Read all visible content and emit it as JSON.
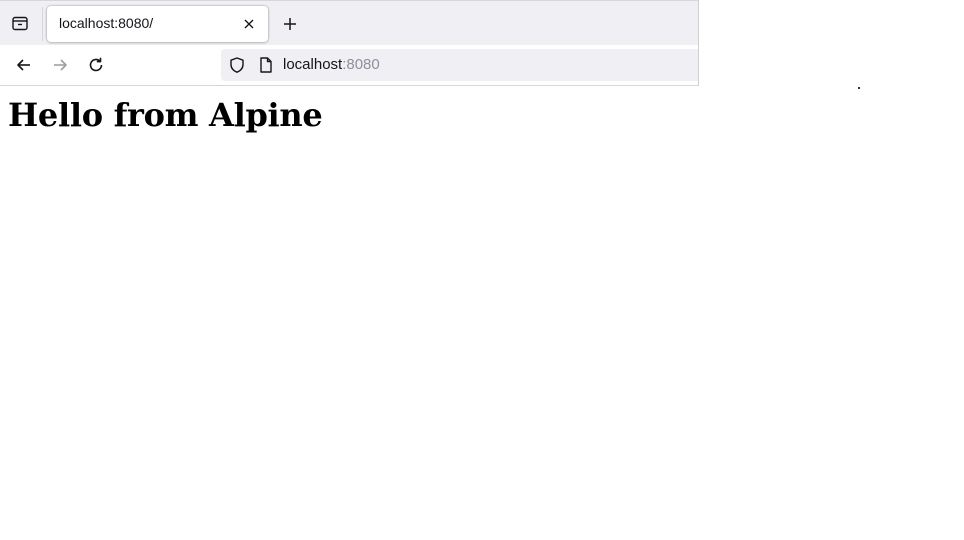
{
  "browser": {
    "tab": {
      "title": "localhost:8080/"
    },
    "address_bar": {
      "host": "localhost",
      "port": ":8080"
    },
    "icons": {
      "tab_list": "tab-list-icon",
      "close": "close-icon",
      "new_tab": "plus-icon",
      "back": "arrow-left-icon",
      "forward": "arrow-right-icon",
      "reload": "reload-icon",
      "tracking_protection": "shield-icon",
      "page_info": "page-icon"
    },
    "colors": {
      "tabbar_bg": "#f0f0f4",
      "urlbar_bg": "#f0f0f4",
      "port_text": "#8f8f9d"
    }
  },
  "page": {
    "heading": "Hello from Alpine"
  }
}
